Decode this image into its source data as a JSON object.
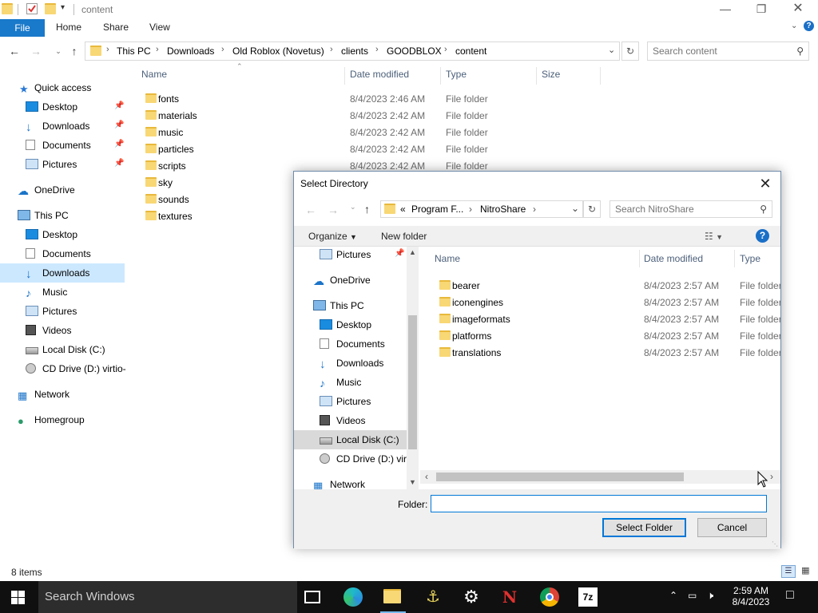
{
  "explorer": {
    "title": "content",
    "ribbon": {
      "file": "File",
      "home": "Home",
      "share": "Share",
      "view": "View"
    },
    "breadcrumb": [
      "This PC",
      "Downloads",
      "Old Roblox (Novetus)",
      "clients",
      "GOODBLOX",
      "content"
    ],
    "search_placeholder": "Search content",
    "columns": {
      "name": "Name",
      "date": "Date modified",
      "type": "Type",
      "size": "Size"
    },
    "files": [
      {
        "name": "fonts",
        "date": "8/4/2023 2:46 AM",
        "type": "File folder"
      },
      {
        "name": "materials",
        "date": "8/4/2023 2:42 AM",
        "type": "File folder"
      },
      {
        "name": "music",
        "date": "8/4/2023 2:42 AM",
        "type": "File folder"
      },
      {
        "name": "particles",
        "date": "8/4/2023 2:42 AM",
        "type": "File folder"
      },
      {
        "name": "scripts",
        "date": "8/4/2023 2:42 AM",
        "type": "File folder"
      },
      {
        "name": "sky",
        "date": "",
        "type": ""
      },
      {
        "name": "sounds",
        "date": "",
        "type": ""
      },
      {
        "name": "textures",
        "date": "",
        "type": ""
      }
    ],
    "nav": {
      "quick_access": "Quick access",
      "qa_items": [
        "Desktop",
        "Downloads",
        "Documents",
        "Pictures"
      ],
      "onedrive": "OneDrive",
      "this_pc": "This PC",
      "pc_items": [
        "Desktop",
        "Documents",
        "Downloads",
        "Music",
        "Pictures",
        "Videos",
        "Local Disk (C:)",
        "CD Drive (D:) virtio-"
      ],
      "network": "Network",
      "homegroup": "Homegroup"
    },
    "status": "8 items"
  },
  "dialog": {
    "title": "Select Directory",
    "breadcrumb": {
      "overflow": "«",
      "items": [
        "Program F...",
        "NitroShare"
      ]
    },
    "search_placeholder": "Search NitroShare",
    "organize": "Organize",
    "new_folder": "New folder",
    "nav": {
      "pictures": "Pictures",
      "onedrive": "OneDrive",
      "this_pc": "This PC",
      "pc_items": [
        "Desktop",
        "Documents",
        "Downloads",
        "Music",
        "Pictures",
        "Videos",
        "Local Disk (C:)",
        "CD Drive (D:) virt"
      ],
      "network": "Network"
    },
    "columns": {
      "name": "Name",
      "date": "Date modified",
      "type": "Type"
    },
    "files": [
      {
        "name": "bearer",
        "date": "8/4/2023 2:57 AM",
        "type": "File folder"
      },
      {
        "name": "iconengines",
        "date": "8/4/2023 2:57 AM",
        "type": "File folder"
      },
      {
        "name": "imageformats",
        "date": "8/4/2023 2:57 AM",
        "type": "File folder"
      },
      {
        "name": "platforms",
        "date": "8/4/2023 2:57 AM",
        "type": "File folder"
      },
      {
        "name": "translations",
        "date": "8/4/2023 2:57 AM",
        "type": "File folder"
      }
    ],
    "folder_label": "Folder:",
    "folder_value": "",
    "select_button": "Select Folder",
    "cancel_button": "Cancel"
  },
  "taskbar": {
    "search_placeholder": "Search Windows",
    "time": "2:59 AM",
    "date": "8/4/2023"
  },
  "colors": {
    "accent": "#0078d7",
    "file_tab": "#1979ca",
    "selection": "#cce8ff",
    "folder": "#f8d775",
    "taskbar": "#101010"
  }
}
